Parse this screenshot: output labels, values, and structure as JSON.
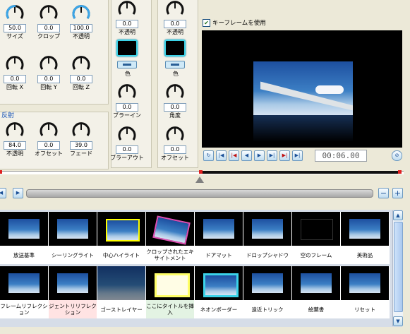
{
  "knobs_left": [
    {
      "label": "サイズ",
      "value": "50.0"
    },
    {
      "label": "クロップ",
      "value": "0.0"
    },
    {
      "label": "不透明",
      "value": "100.0"
    },
    {
      "label": "回転 X",
      "value": "0.0"
    },
    {
      "label": "回転 Y",
      "value": "0.0"
    },
    {
      "label": "回転 Z",
      "value": "0.0"
    }
  ],
  "reflection": {
    "section_label": "反射",
    "knobs": [
      {
        "label": "不透明",
        "value": "84.0"
      },
      {
        "label": "オフセット",
        "value": "0.0"
      },
      {
        "label": "フェード",
        "value": "39.0"
      }
    ]
  },
  "shadow_column": {
    "opacity": {
      "label": "不透明",
      "value": "0.0"
    },
    "color_label": "色",
    "blur": {
      "label": "ブラーイン",
      "value": "0.0"
    },
    "blur_out": {
      "label": "ブラーアウト",
      "value": "0.0"
    }
  },
  "border_column": {
    "opacity": {
      "label": "不透明",
      "value": "0.0"
    },
    "color_label": "色",
    "angle": {
      "label": "角度",
      "value": "0.0"
    },
    "offset": {
      "label": "オフセット",
      "value": "0.0"
    }
  },
  "preview": {
    "keyframe_label": "キーフレームを使用",
    "keyframe_checked": true,
    "timecode": "00:06.00"
  },
  "colors": {
    "accent": "#3bd3e8",
    "selection": "#ffff00",
    "marker": "#e02020"
  },
  "thumbnails": [
    {
      "label": "放送基準",
      "bg": "#ffffff"
    },
    {
      "label": "シーリングライト",
      "bg": "#ffffff"
    },
    {
      "label": "中心ハイライト",
      "bg": "#ffffff"
    },
    {
      "label": "クロップされたエキサイトメント",
      "bg": "#ffffff"
    },
    {
      "label": "ドアマット",
      "bg": "#ffffff"
    },
    {
      "label": "ドロップシャドウ",
      "bg": "#ffffff"
    },
    {
      "label": "空のフレーム",
      "bg": "#ffffff"
    },
    {
      "label": "美術品",
      "bg": "#ffffff"
    },
    {
      "label": "フレームリフレクション",
      "bg": "#ffffff"
    },
    {
      "label": "ジェントリリフレクション",
      "bg": "#ffe3e3"
    },
    {
      "label": "ゴーストレイヤー",
      "bg": "#ffffff"
    },
    {
      "label": "ここにタイトルを挿入",
      "bg": "#e3f3e3"
    },
    {
      "label": "ネオンボーダー",
      "bg": "#ffffff"
    },
    {
      "label": "遠近トリック",
      "bg": "#ffffff"
    },
    {
      "label": "絵葉書",
      "bg": "#ffffff"
    },
    {
      "label": "リセット",
      "bg": "#ffffff"
    }
  ]
}
